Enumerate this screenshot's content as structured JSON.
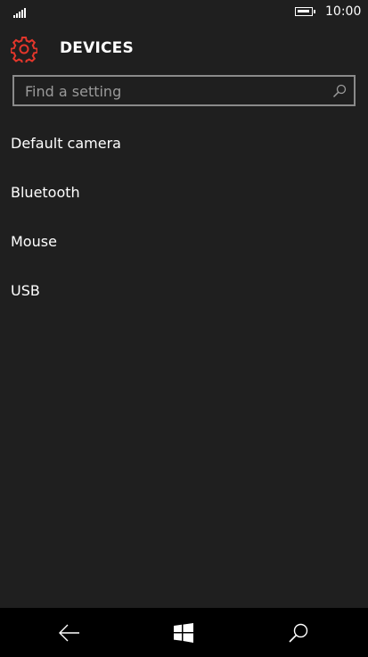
{
  "status_bar": {
    "signal_icon": "signal-strength-icon",
    "battery_icon": "battery-icon",
    "time": "10:00"
  },
  "header": {
    "icon": "gear-icon",
    "title": "DEVICES",
    "accent_color": "#e3362b"
  },
  "search": {
    "placeholder": "Find a setting",
    "icon": "search-icon"
  },
  "settings_list": [
    {
      "label": "Default camera"
    },
    {
      "label": "Bluetooth"
    },
    {
      "label": "Mouse"
    },
    {
      "label": "USB"
    }
  ],
  "nav_bar": {
    "back_icon": "back-arrow-icon",
    "start_icon": "windows-logo-icon",
    "search_icon": "search-icon"
  }
}
